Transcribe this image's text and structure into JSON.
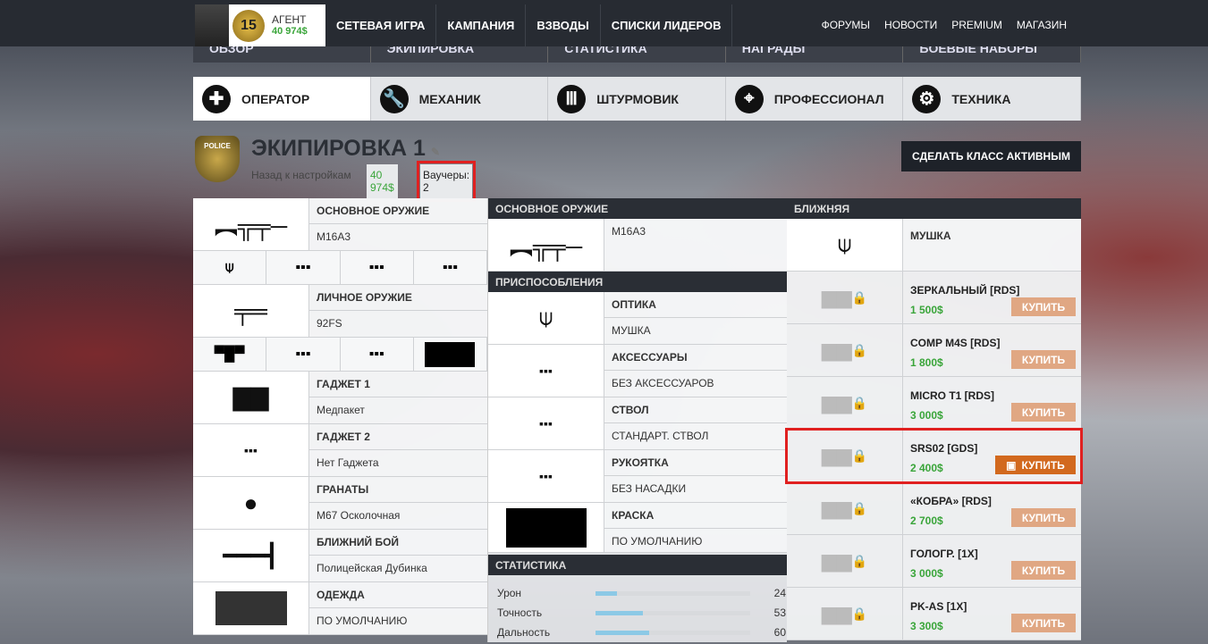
{
  "profile": {
    "rank": "15",
    "name": "АГЕНТ",
    "money": "40 974$"
  },
  "nav": [
    "СЕТЕВАЯ ИГРА",
    "КАМПАНИЯ",
    "ВЗВОДЫ",
    "СПИСКИ ЛИДЕРОВ"
  ],
  "nav_right": [
    "ФОРУМЫ",
    "НОВОСТИ",
    "PREMIUM",
    "МАГАЗИН"
  ],
  "subtabs": [
    "ОБЗОР",
    "ЭКИПИРОВКА",
    "СТАТИСТИКА",
    "НАГРАДЫ",
    "БОЕВЫЕ НАБОРЫ"
  ],
  "classes": [
    "ОПЕРАТОР",
    "МЕХАНИК",
    "ШТУРМОВИК",
    "ПРОФЕССИОНАЛ",
    "ТЕХНИКА"
  ],
  "header": {
    "title": "ЭКИПИРОВКА 1",
    "back": "Назад к настройкам",
    "money": "40 974$",
    "vouchers": "Ваучеры: 2",
    "activate": "СДЕЛАТЬ КЛАСС АКТИВНЫМ",
    "badge": "POLICE"
  },
  "left": {
    "primary": {
      "label": "ОСНОВНОЕ ОРУЖИЕ",
      "value": "M16A3"
    },
    "pistol": {
      "label": "ЛИЧНОЕ ОРУЖИЕ",
      "value": "92FS"
    },
    "gadget1": {
      "label": "ГАДЖЕТ 1",
      "value": "Медпакет"
    },
    "gadget2": {
      "label": "ГАДЖЕТ 2",
      "value": "Нет Гаджета"
    },
    "grenades": {
      "label": "ГРАНАТЫ",
      "value": "M67 Осколочная"
    },
    "melee": {
      "label": "БЛИЖНИЙ БОЙ",
      "value": "Полицейская Дубинка"
    },
    "clothing": {
      "label": "ОДЕЖДА",
      "value": "ПО УМОЛЧАНИЮ"
    }
  },
  "mid": {
    "weapon_head": "ОСНОВНОЕ ОРУЖИЕ",
    "weapon": "M16A3",
    "attach_head": "ПРИСПОСОБЛЕНИЯ",
    "attachments": [
      {
        "label": "ОПТИКА",
        "value": "МУШКА"
      },
      {
        "label": "АКСЕССУАРЫ",
        "value": "БЕЗ АКСЕССУАРОВ"
      },
      {
        "label": "СТВОЛ",
        "value": "СТАНДАРТ. СТВОЛ"
      },
      {
        "label": "РУКОЯТКА",
        "value": "БЕЗ НАСАДКИ"
      },
      {
        "label": "КРАСКА",
        "value": "ПО УМОЛЧАНИЮ"
      }
    ],
    "stats_head": "СТАТИСТИКА",
    "stats": [
      {
        "name": "Урон",
        "value": 24
      },
      {
        "name": "Точность",
        "value": 53
      },
      {
        "name": "Дальность",
        "value": 60
      }
    ],
    "stats_max": 173
  },
  "right": {
    "head": "БЛИЖНЯЯ",
    "current": "МУШКА",
    "buy": "КУПИТЬ",
    "items": [
      {
        "name": "ЗЕРКАЛЬНЫЙ [RDS]",
        "price": "1 500$"
      },
      {
        "name": "COMP M4S [RDS]",
        "price": "1 800$"
      },
      {
        "name": "MICRO T1 [RDS]",
        "price": "3 000$"
      },
      {
        "name": "SRS02 [GDS]",
        "price": "2 400$"
      },
      {
        "name": "«КОБРА» [RDS]",
        "price": "2 700$"
      },
      {
        "name": "ГОЛОГР. [1X]",
        "price": "3 000$"
      },
      {
        "name": "PK-AS [1X]",
        "price": "3 300$"
      }
    ]
  }
}
